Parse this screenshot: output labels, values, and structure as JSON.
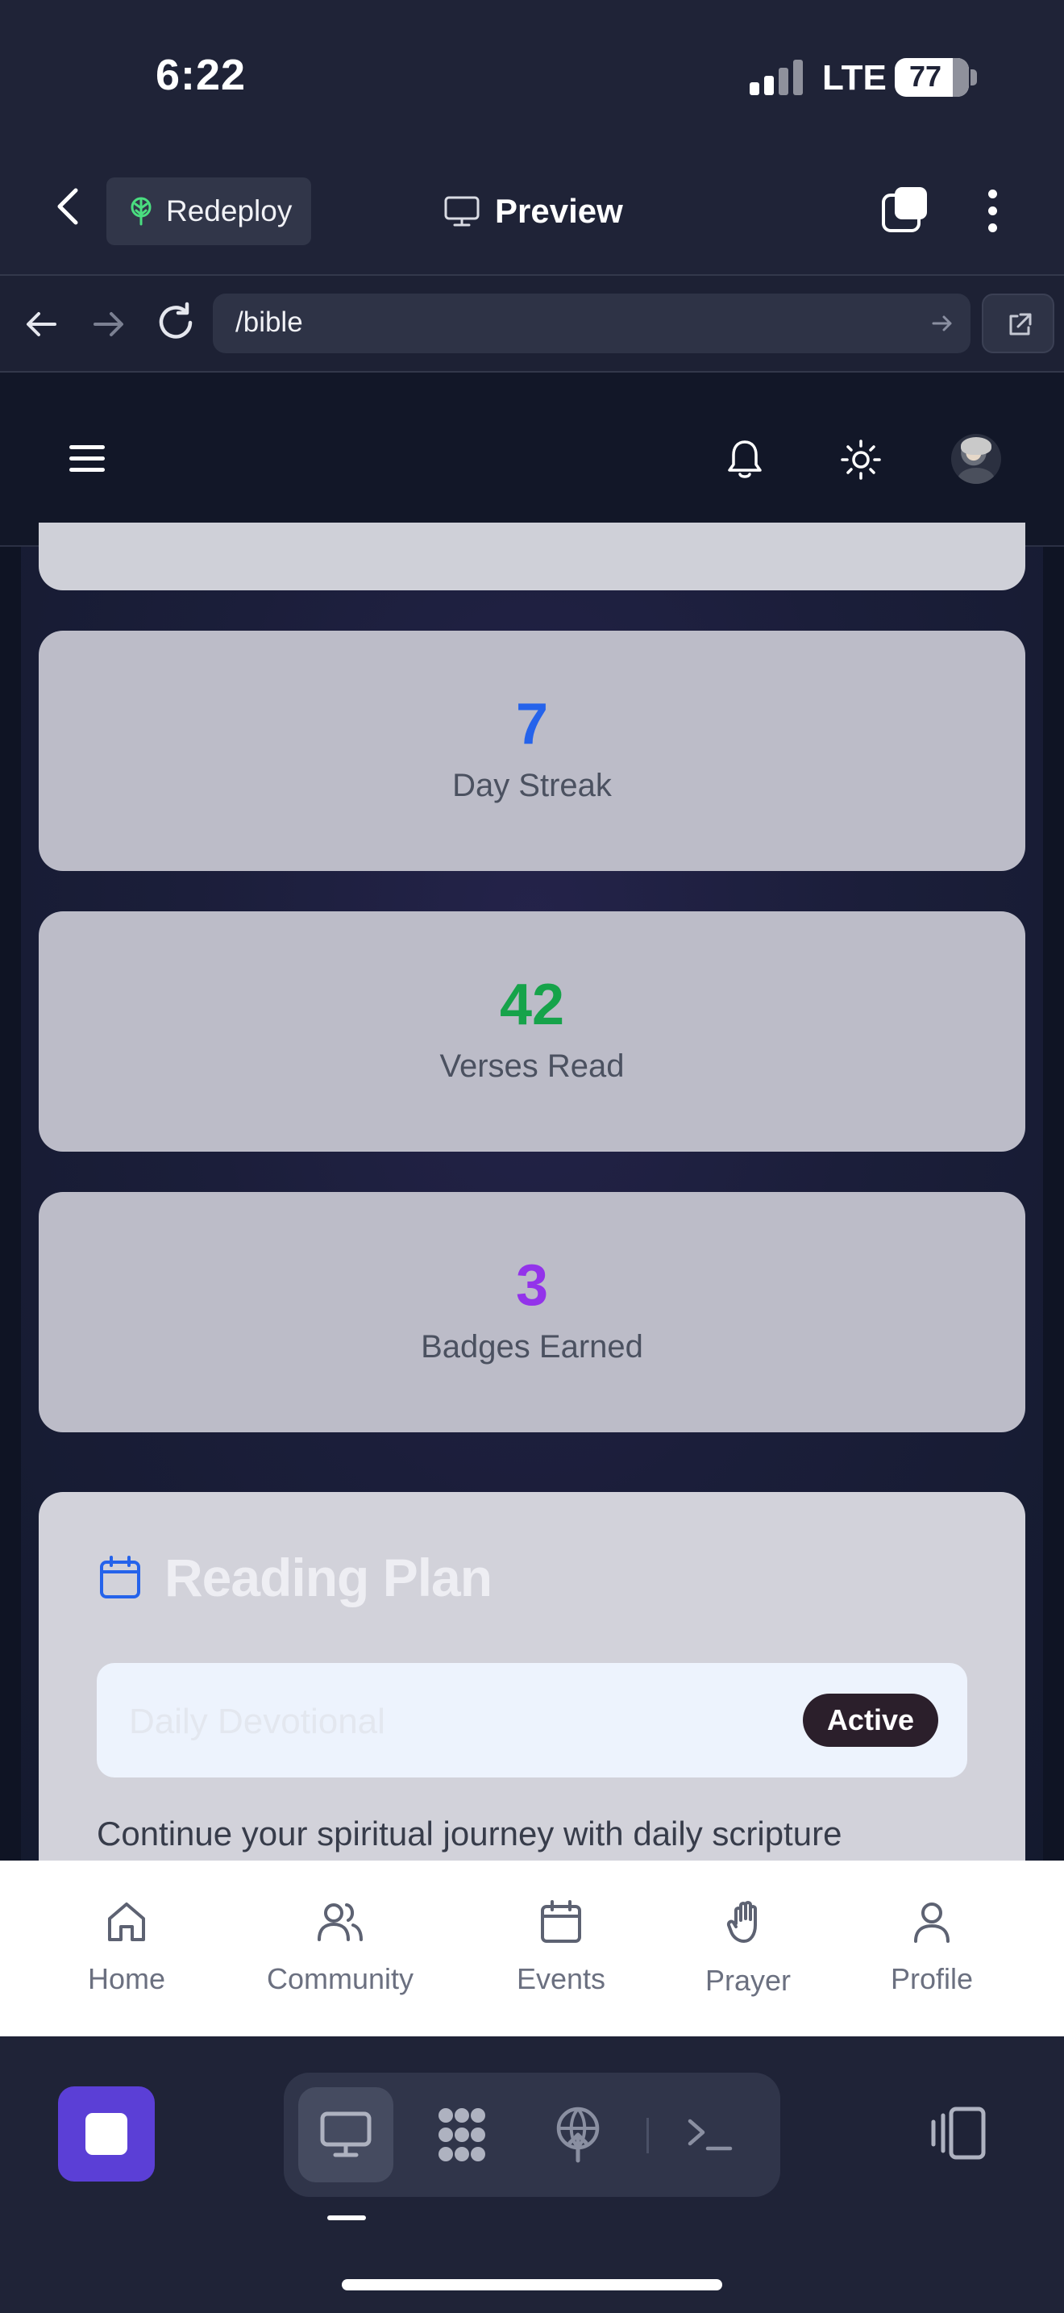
{
  "status_bar": {
    "time": "6:22",
    "network": "LTE",
    "battery": "77"
  },
  "app_header": {
    "redeploy_label": "Redeploy",
    "preview_label": "Preview"
  },
  "browser": {
    "url": "/bible"
  },
  "stats": [
    {
      "value": "7",
      "label": "Day Streak",
      "color": "#2563eb"
    },
    {
      "value": "42",
      "label": "Verses Read",
      "color": "#16a34a"
    },
    {
      "value": "3",
      "label": "Badges Earned",
      "color": "#9333ea"
    }
  ],
  "reading_plan": {
    "title": "Reading Plan",
    "plan_name": "Daily Devotional",
    "status_badge": "Active",
    "description": "Continue your spiritual journey with daily scripture"
  },
  "tab_nav": {
    "items": [
      {
        "label": "Home",
        "icon": "home-icon"
      },
      {
        "label": "Community",
        "icon": "community-icon"
      },
      {
        "label": "Events",
        "icon": "calendar-icon"
      },
      {
        "label": "Prayer",
        "icon": "prayer-hand-icon"
      },
      {
        "label": "Profile",
        "icon": "profile-icon"
      }
    ]
  },
  "colors": {
    "accent_purple": "#5b3fd6",
    "app_background": "#1f2337"
  }
}
